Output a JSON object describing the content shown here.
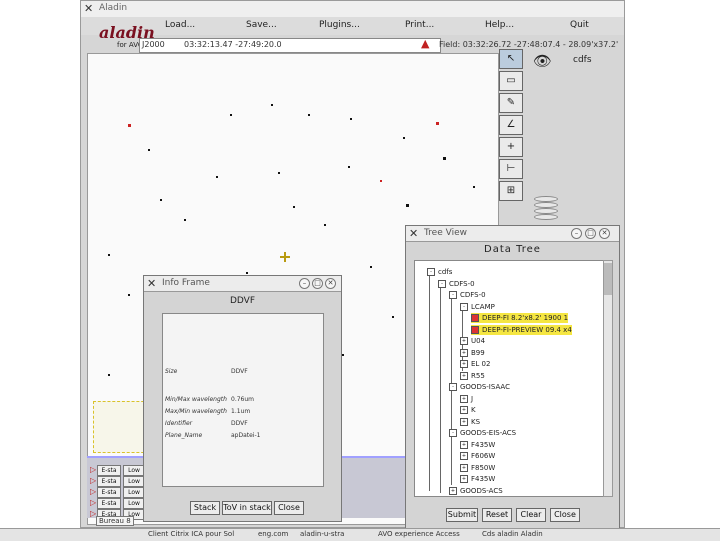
{
  "main_window": {
    "title": "Aladin",
    "menu": [
      "Load...",
      "Save...",
      "Plugins...",
      "Print...",
      "Help...",
      "Quit"
    ],
    "logo_text": "aladin",
    "logo_sub": "for AVO",
    "coord_combo": "J2000",
    "coord_value": "03:32:13.47 -27:49:20.0",
    "field_text": "Field: 03:32:26.72 -27:48:07.4 - 28.09'x37.2'",
    "plane_label": "cdfs"
  },
  "stack_rows": [
    {
      "cell1": "E-sta",
      "cell2": "Low"
    },
    {
      "cell1": "E-sta",
      "cell2": "Low"
    },
    {
      "cell1": "E-sta",
      "cell2": "Low"
    },
    {
      "cell1": "E-sta",
      "cell2": "Low"
    },
    {
      "cell1": "E-sta",
      "cell2": "Low"
    }
  ],
  "info_frame": {
    "title": "Info Frame",
    "name": "DDVF",
    "rows": [
      {
        "label": "Size",
        "value": "DDVF"
      },
      {
        "label": "Min/Max wavelength",
        "value": "0.76um"
      },
      {
        "label": "Max/Min wavelength",
        "value": "1.1um"
      },
      {
        "label": "Identifier",
        "value": "DDVF"
      },
      {
        "label": "Plane_Name",
        "value": "apDatei-1"
      }
    ],
    "buttons": [
      "Stack",
      "ToV in stack",
      "Close"
    ]
  },
  "tree_view": {
    "title": "Tree View",
    "header": "Data Tree",
    "nodes": [
      {
        "label": "cdfs",
        "depth": 0,
        "box": "-"
      },
      {
        "label": "CDFS-0",
        "depth": 1,
        "box": "-"
      },
      {
        "label": "CDFS-0",
        "depth": 2,
        "box": "-"
      },
      {
        "label": "LCAMP",
        "depth": 3,
        "box": "-"
      },
      {
        "label": "DEEP-FI 8.2'x8.2' 1900 1",
        "depth": 4,
        "box": "red",
        "highlight": true
      },
      {
        "label": "DEEP-FI-PREVIEW 09.4 x4",
        "depth": 4,
        "box": "red",
        "highlight": true
      },
      {
        "label": "U04",
        "depth": 3,
        "box": "+"
      },
      {
        "label": "B99",
        "depth": 3,
        "box": "+"
      },
      {
        "label": "EL 02",
        "depth": 3,
        "box": "+"
      },
      {
        "label": "R55",
        "depth": 3,
        "box": "+"
      },
      {
        "label": "GOODS-ISAAC",
        "depth": 2,
        "box": "-"
      },
      {
        "label": "J",
        "depth": 3,
        "box": "+"
      },
      {
        "label": "K",
        "depth": 3,
        "box": "+"
      },
      {
        "label": "KS",
        "depth": 3,
        "box": "+"
      },
      {
        "label": "GOODS-EIS-ACS",
        "depth": 2,
        "box": "-"
      },
      {
        "label": "F435W",
        "depth": 3,
        "box": "+"
      },
      {
        "label": "F606W",
        "depth": 3,
        "box": "+"
      },
      {
        "label": "F850W",
        "depth": 3,
        "box": "+"
      },
      {
        "label": "F435W",
        "depth": 3,
        "box": "+"
      },
      {
        "label": "GOODS-ACS",
        "depth": 2,
        "box": "+"
      }
    ],
    "buttons": [
      "Submit",
      "Reset",
      "Clear",
      "Close"
    ]
  },
  "taskbar": {
    "desktop_label": "Bureau 8",
    "items": [
      "Client Citrix ICA pour Sol",
      "eng.com",
      "aladin-u-stra",
      "AVO experience Access",
      "Cds aladin Aladin"
    ]
  }
}
